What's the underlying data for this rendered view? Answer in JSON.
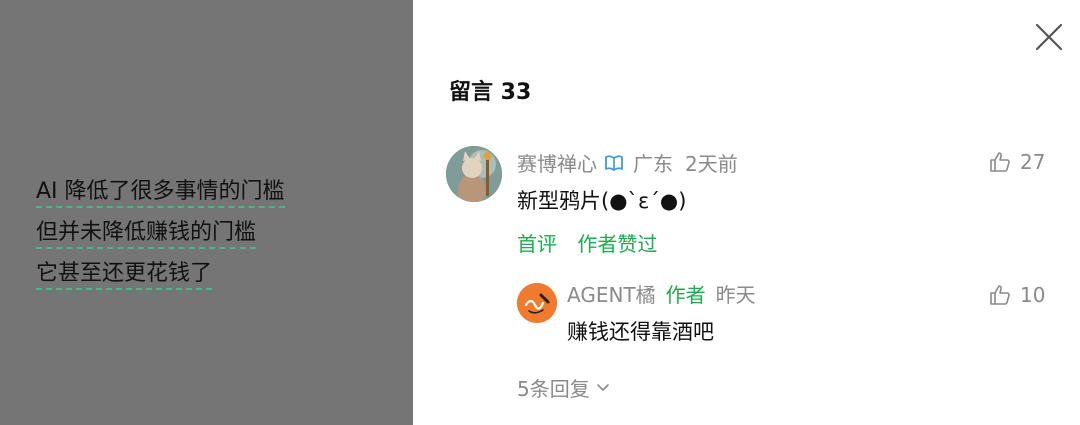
{
  "preview": {
    "lines": [
      "AI 降低了很多事情的门槛",
      "但并未降低赚钱的门槛",
      "它甚至还更花钱了"
    ]
  },
  "panel": {
    "title": "留言 33"
  },
  "comment": {
    "user": "赛博禅心",
    "location": "广东",
    "time": "2天前",
    "text": "新型鸦片(●`ε´●)",
    "tag_first": "首评",
    "tag_author_liked": "作者赞过",
    "likes": "27",
    "reply": {
      "user": "AGENT橘",
      "author_tag": "作者",
      "time": "昨天",
      "text": "赚钱还得靠酒吧",
      "likes": "10"
    },
    "more_replies": "5条回复"
  },
  "colors": {
    "accent": "#1aad4f",
    "badge": "#3a9be0",
    "reply_avatar": "#f07b2f",
    "left_bg": "#757575"
  },
  "icons": [
    "close-icon",
    "verified-badge-icon",
    "thumb-up-icon",
    "chevron-down-icon"
  ]
}
